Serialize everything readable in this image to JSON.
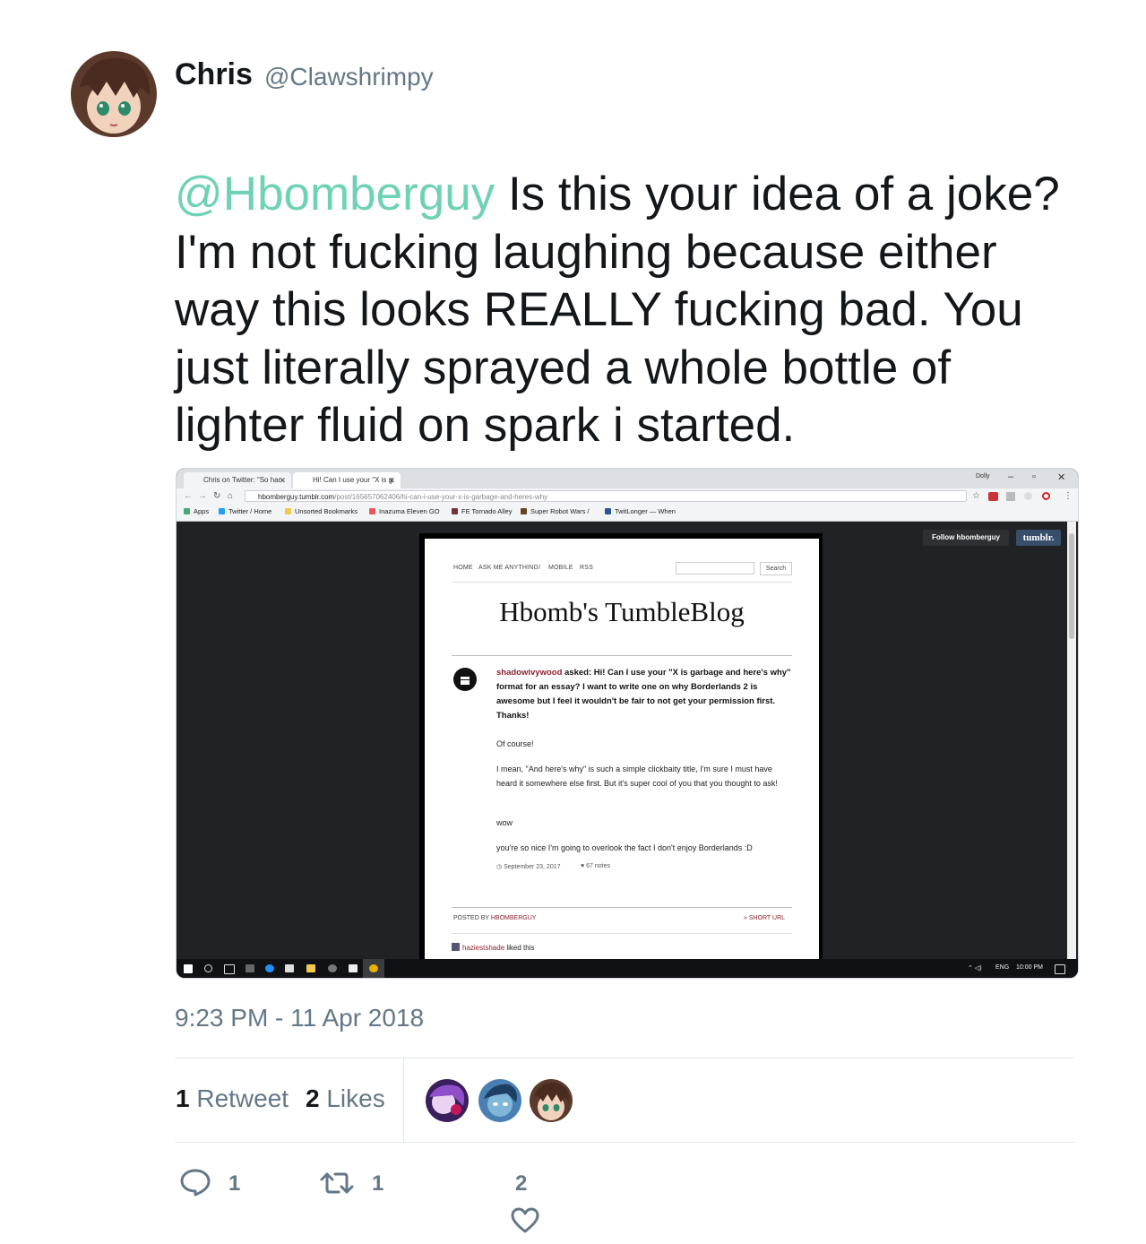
{
  "author": {
    "name": "Chris",
    "handle": "@Clawshrimpy"
  },
  "tweet": {
    "mention": "@Hbomberguy",
    "text": " Is this your idea of a joke? I'm not fucking laughing because either way this looks REALLY fucking bad. You just literally sprayed a whole bottle of lighter fluid on spark i started.",
    "timestamp": "9:23 PM - 11 Apr 2018"
  },
  "stats": {
    "retweets_count": "1",
    "retweets_label": "Retweet",
    "likes_count": "2",
    "likes_label": "Likes"
  },
  "actions": {
    "replies": "1",
    "retweets": "1",
    "likes": "2"
  },
  "embedded_screenshot": {
    "tabs": [
      "Chris on Twitter: \"So har",
      "Hi! Can I use your \"X is g"
    ],
    "window_user": "Dolly",
    "url_host": "hbomberguy.tumblr.com",
    "url_path": "/post/165657062406/hi-can-i-use-your-x-is-garbage-and-heres-why",
    "bookmarks": [
      "Apps",
      "Twitter / Home",
      "Unsorted Bookmarks",
      "Inazuma Eleven GO",
      "FE Tornado Alley",
      "Super Robot Wars /",
      "TwitLonger — When"
    ],
    "follow_button": "Follow hbomberguy",
    "tumblr_logo": "tumblr.",
    "blog_nav": [
      "HOME",
      "ASK ME ANYTHING!",
      "MOBILE",
      "RSS"
    ],
    "search_button": "Search",
    "blog_title": "Hbomb's TumbleBlog",
    "asker": "shadowivywood",
    "question": " asked: Hi! Can I use your \"X is garbage and here's why\" format for an essay? I want to write one on why Borderlands 2 is awesome but I feel it wouldn't be fair to not get your permission first. Thanks!",
    "answer_paragraphs": [
      "Of course!",
      "I mean, \"And here's why\" is such a simple clickbaity title, I'm sure I must have heard it somewhere else first. But it's super cool of you that you thought to ask!",
      "wow",
      "you're so nice I'm going to overlook the fact I don't enjoy Borderlands :D"
    ],
    "post_date": "September 23, 2017",
    "post_notes": "67 notes",
    "posted_by_label": "POSTED BY ",
    "posted_by_user": "HBOMBERGUY",
    "short_url": "» SHORT URL",
    "note_user": "haziestshade",
    "note_action": " liked this",
    "taskbar_lang": "ENG",
    "taskbar_time": "10:00 PM"
  },
  "icons": [
    "reply-icon",
    "retweet-icon",
    "heart-icon",
    "star-icon",
    "windows-start-icon"
  ]
}
